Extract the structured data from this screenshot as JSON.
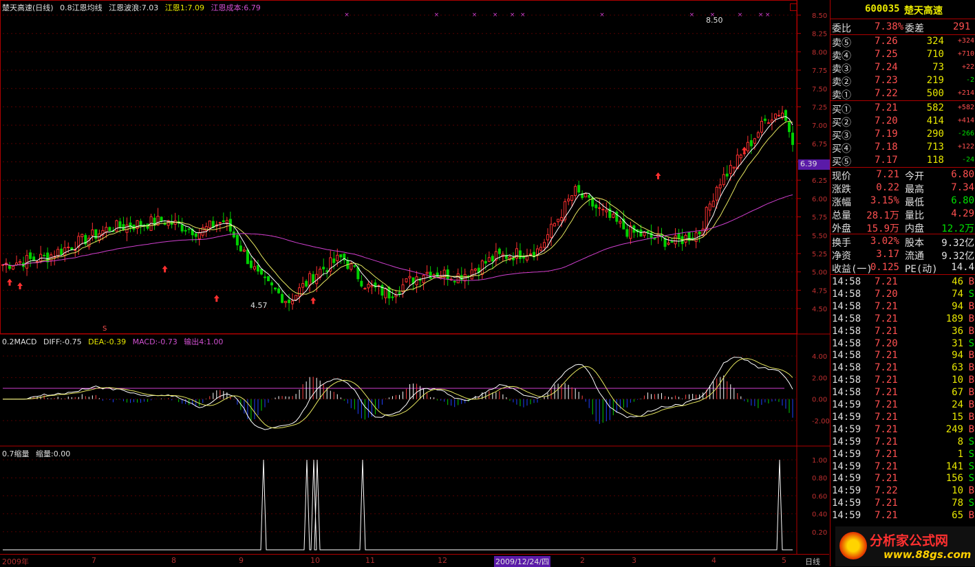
{
  "main_legend": {
    "title": "楚天高速(日线)",
    "ind1": "0.8江恩均线",
    "ind2": "江恩波浪:7.03",
    "ind3": "江恩1:7.09",
    "ind4": "江恩成本:6.79"
  },
  "macd_legend": {
    "name": "0.2MACD",
    "diff": "DIFF:-0.75",
    "dea": "DEA:-0.39",
    "macd": "MACD:-0.73",
    "out": "输出4:1.00"
  },
  "vol_legend": {
    "name": "0.7缩量",
    "value": "缩量:0.00"
  },
  "annotations": {
    "high": "8.50",
    "low": "4.57",
    "price_tag": "6.39",
    "s_mark": "S"
  },
  "price_ticks": [
    "8.50",
    "8.25",
    "8.00",
    "7.75",
    "7.50",
    "7.25",
    "7.00",
    "6.75",
    "6.50",
    "6.25",
    "6.00",
    "5.75",
    "5.50",
    "5.25",
    "5.00",
    "4.75",
    "4.50"
  ],
  "macd_ticks": [
    "4.00",
    "2.00",
    "0.00",
    "-2.00"
  ],
  "vol_ticks": [
    "1.00",
    "0.80",
    "0.60",
    "0.40",
    "0.20"
  ],
  "x_labels": [
    "2009年",
    "7",
    "8",
    "9",
    "10",
    "11",
    "12",
    "2009/12/24/四",
    "2",
    "3",
    "4",
    "5"
  ],
  "period_label": "日线",
  "stock": {
    "code": "600035",
    "name": "楚天高速"
  },
  "order_book": {
    "ratio_label": "委比",
    "ratio": "7.38%",
    "diff_label": "委差",
    "diff": "291",
    "sells": [
      {
        "label": "卖⑤",
        "price": "7.26",
        "vol": "324",
        "chg": "+324"
      },
      {
        "label": "卖④",
        "price": "7.25",
        "vol": "710",
        "chg": "+710"
      },
      {
        "label": "卖③",
        "price": "7.24",
        "vol": "73",
        "chg": "+22"
      },
      {
        "label": "卖②",
        "price": "7.23",
        "vol": "219",
        "chg": "-2"
      },
      {
        "label": "卖①",
        "price": "7.22",
        "vol": "500",
        "chg": "+214"
      }
    ],
    "buys": [
      {
        "label": "买①",
        "price": "7.21",
        "vol": "582",
        "chg": "+582"
      },
      {
        "label": "买②",
        "price": "7.20",
        "vol": "414",
        "chg": "+414"
      },
      {
        "label": "买③",
        "price": "7.19",
        "vol": "290",
        "chg": "-266"
      },
      {
        "label": "买④",
        "price": "7.18",
        "vol": "713",
        "chg": "+122"
      },
      {
        "label": "买⑤",
        "price": "7.17",
        "vol": "118",
        "chg": "-24"
      }
    ]
  },
  "quote": [
    {
      "l1": "现价",
      "v1": "7.21",
      "l2": "今开",
      "v2": "6.80"
    },
    {
      "l1": "涨跌",
      "v1": "0.22",
      "l2": "最高",
      "v2": "7.34"
    },
    {
      "l1": "涨幅",
      "v1": "3.15%",
      "l2": "最低",
      "v2": "6.80"
    },
    {
      "l1": "总量",
      "v1": "28.1万",
      "l2": "量比",
      "v2": "4.29"
    },
    {
      "l1": "外盘",
      "v1": "15.9万",
      "l2": "内盘",
      "v2": "12.2万"
    }
  ],
  "fundamentals": [
    {
      "l1": "换手",
      "v1": "3.02%",
      "l2": "股本",
      "v2": "9.32亿"
    },
    {
      "l1": "净资",
      "v1": "3.17",
      "l2": "流通",
      "v2": "9.32亿"
    },
    {
      "l1": "收益(一)",
      "v1": "0.125",
      "l2": "PE(动)",
      "v2": "14.4"
    }
  ],
  "ticks": [
    {
      "t": "14:58",
      "p": "7.21",
      "v": "46",
      "s": "B"
    },
    {
      "t": "14:58",
      "p": "7.20",
      "v": "74",
      "s": "S"
    },
    {
      "t": "14:58",
      "p": "7.21",
      "v": "94",
      "s": "B"
    },
    {
      "t": "14:58",
      "p": "7.21",
      "v": "189",
      "s": "B"
    },
    {
      "t": "14:58",
      "p": "7.21",
      "v": "36",
      "s": "B"
    },
    {
      "t": "14:58",
      "p": "7.20",
      "v": "31",
      "s": "S"
    },
    {
      "t": "14:58",
      "p": "7.21",
      "v": "94",
      "s": "B"
    },
    {
      "t": "14:58",
      "p": "7.21",
      "v": "63",
      "s": "B"
    },
    {
      "t": "14:58",
      "p": "7.21",
      "v": "10",
      "s": "B"
    },
    {
      "t": "14:58",
      "p": "7.21",
      "v": "67",
      "s": "B"
    },
    {
      "t": "14:59",
      "p": "7.21",
      "v": "24",
      "s": "B"
    },
    {
      "t": "14:59",
      "p": "7.21",
      "v": "15",
      "s": "B"
    },
    {
      "t": "14:59",
      "p": "7.21",
      "v": "249",
      "s": "B"
    },
    {
      "t": "14:59",
      "p": "7.21",
      "v": "8",
      "s": "S"
    },
    {
      "t": "14:59",
      "p": "7.21",
      "v": "1",
      "s": "S"
    },
    {
      "t": "14:59",
      "p": "7.21",
      "v": "141",
      "s": "S"
    },
    {
      "t": "14:59",
      "p": "7.21",
      "v": "156",
      "s": "S"
    },
    {
      "t": "14:59",
      "p": "7.22",
      "v": "10",
      "s": "B"
    },
    {
      "t": "14:59",
      "p": "7.21",
      "v": "78",
      "s": "S"
    },
    {
      "t": "14:59",
      "p": "7.21",
      "v": "65",
      "s": "B"
    }
  ],
  "watermark": {
    "brand": "分析家公式网",
    "url": "www.88gs.com"
  }
}
